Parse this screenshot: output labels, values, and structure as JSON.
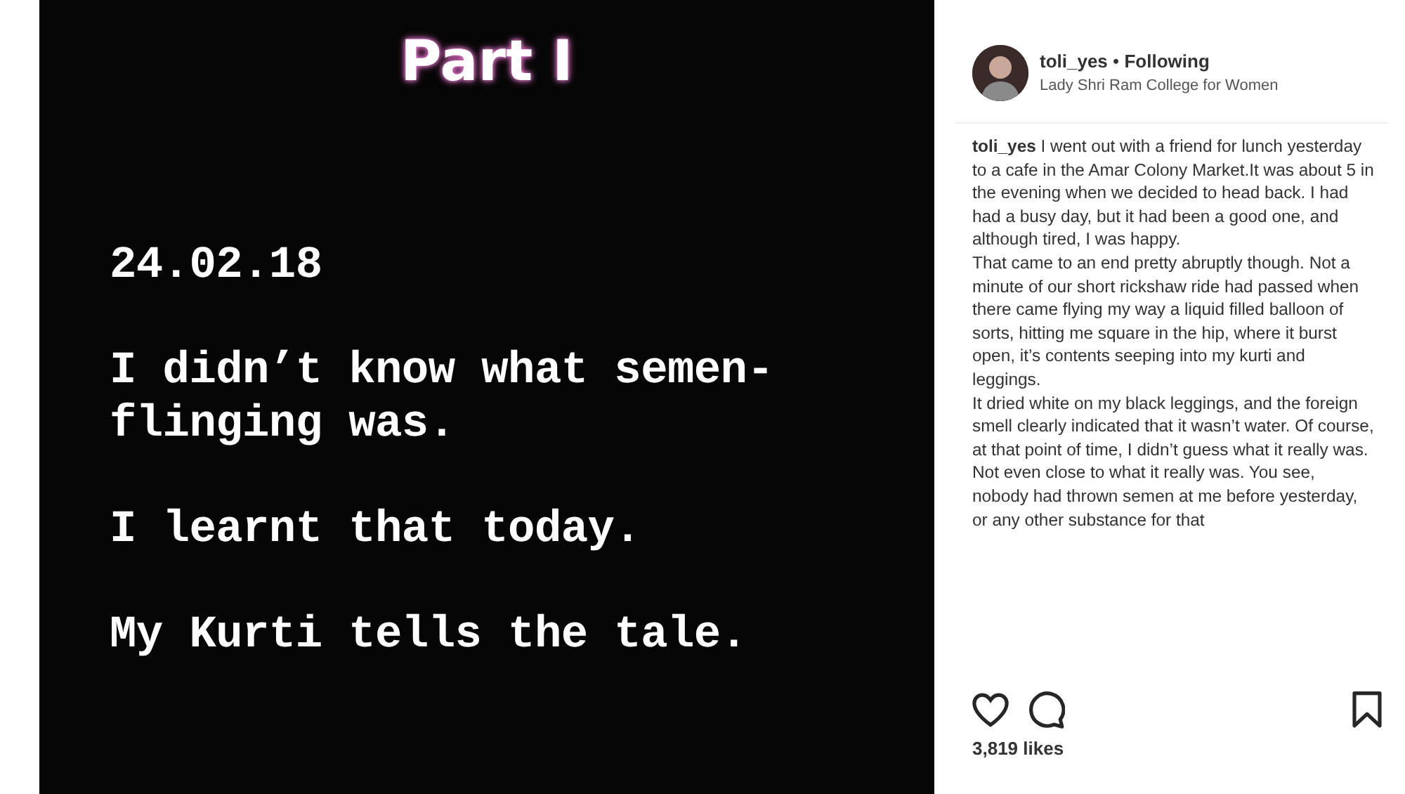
{
  "post_image": {
    "title": "Part I",
    "lines": [
      "24.02.18",
      "I didn’t know what semen-\nflinging was.",
      "I learnt that today.",
      "My Kurti tells the tale."
    ]
  },
  "header": {
    "username": "toli_yes",
    "separator": "•",
    "follow_state": "Following",
    "location": "Lady Shri Ram College for Women"
  },
  "caption": [
    "**toli_yes** I went out with a friend for lunch yesterday to a cafe in the Amar Colony Market.It was about 5 in the evening when we decided to head back. I had had a busy day, but it had been a good one, and although tired, I was happy.",
    "That came to an end pretty abruptly though. Not a minute of our short rickshaw ride had passed when there came flying my way a liquid filled balloon of sorts, hitting me square in the hip, where it burst open, it’s contents seeping into my kurti and leggings.",
    "It dried white on my black leggings, and the foreign smell clearly indicated that it wasn’t water. Of course, at that point of time, I didn’t guess what it really was. Not even close to what it really was. You see, nobody had thrown semen at me before yesterday, or any other substance for that"
  ],
  "actions": [
    {
      "kind": "like"
    },
    {
      "kind": "comment"
    },
    {
      "kind": "save"
    }
  ],
  "likes": "3,819 likes"
}
